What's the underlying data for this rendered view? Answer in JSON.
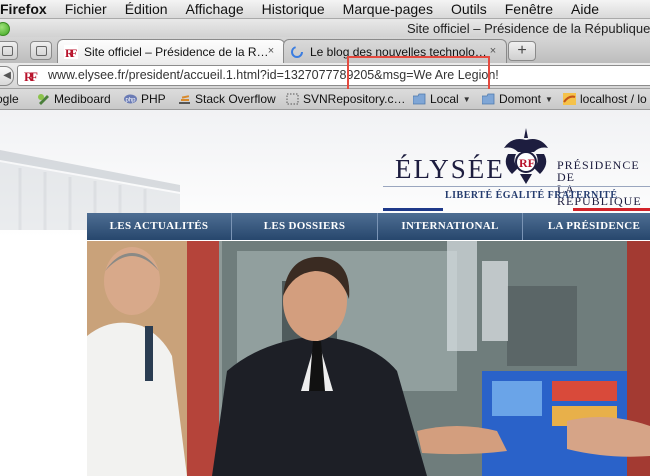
{
  "menubar": {
    "app": "Firefox",
    "items": [
      "Fichier",
      "Édition",
      "Affichage",
      "Historique",
      "Marque-pages",
      "Outils",
      "Fenêtre",
      "Aide"
    ]
  },
  "window": {
    "title": "Site officiel – Présidence de la République"
  },
  "tabs": [
    {
      "label": "Site officiel – Présidence de la R…",
      "active": true,
      "icon": "rf-monogram-icon"
    },
    {
      "label": "Le blog des nouvelles technolo…",
      "active": false,
      "icon": "loading-spinner-icon"
    }
  ],
  "newtab_label": "+",
  "tab_close_glyph": "×",
  "navbar": {
    "url": "www.elysee.fr/president/accueil.1.html?id=1327077789205&msg=We Are Legion!"
  },
  "bookmarks": [
    {
      "label": "ogle",
      "icon": "none"
    },
    {
      "label": "Mediboard",
      "icon": "mediboard-icon"
    },
    {
      "label": "PHP",
      "icon": "php-icon"
    },
    {
      "label": "Stack Overflow",
      "icon": "stackoverflow-icon"
    },
    {
      "label": "SVNRepository.c…",
      "icon": "dotted-box-icon"
    },
    {
      "label": "Local",
      "icon": "folder-icon",
      "folder": true
    },
    {
      "label": "Domont",
      "icon": "folder-icon",
      "folder": true
    },
    {
      "label": "localhost / lo",
      "icon": "phpmyadmin-icon"
    }
  ],
  "site": {
    "logo_text": "ÉLYSÉE",
    "presidence_line1": "PRÉSIDENCE DE",
    "presidence_line2": "LA RÉPUBLIQUE",
    "motto": "LIBERTÉ ÉGALITÉ FRATERNITÉ",
    "nav": [
      "LES ACTUALITÉS",
      "LES DOSSIERS",
      "INTERNATIONAL",
      "LA PRÉSIDENCE"
    ]
  },
  "colors": {
    "accent_red": "#e54a3f",
    "nav_blue": "#27476d",
    "flag_blue": "#1f3a8a",
    "flag_red": "#d2232a"
  }
}
